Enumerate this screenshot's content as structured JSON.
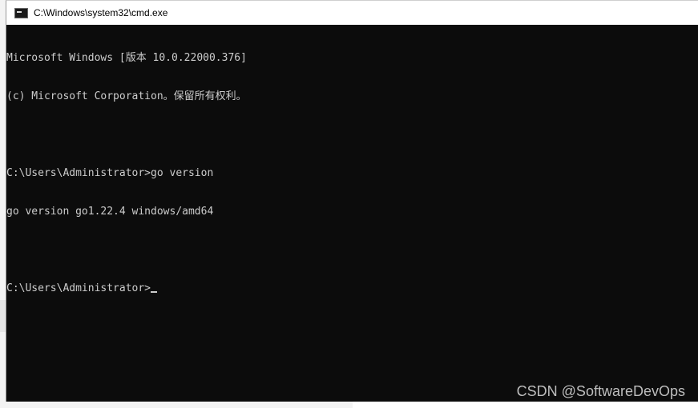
{
  "window": {
    "title": "C:\\Windows\\system32\\cmd.exe",
    "icon": "cmd-icon"
  },
  "console": {
    "lines": [
      "Microsoft Windows [版本 10.0.22000.376]",
      "(c) Microsoft Corporation。保留所有权利。",
      "",
      "C:\\Users\\Administrator>go version",
      "go version go1.22.4 windows/amd64",
      "",
      "C:\\Users\\Administrator>"
    ]
  },
  "watermark": "CSDN @SoftwareDevOps",
  "colors": {
    "console_bg": "#0c0c0c",
    "console_text": "#cccccc"
  }
}
